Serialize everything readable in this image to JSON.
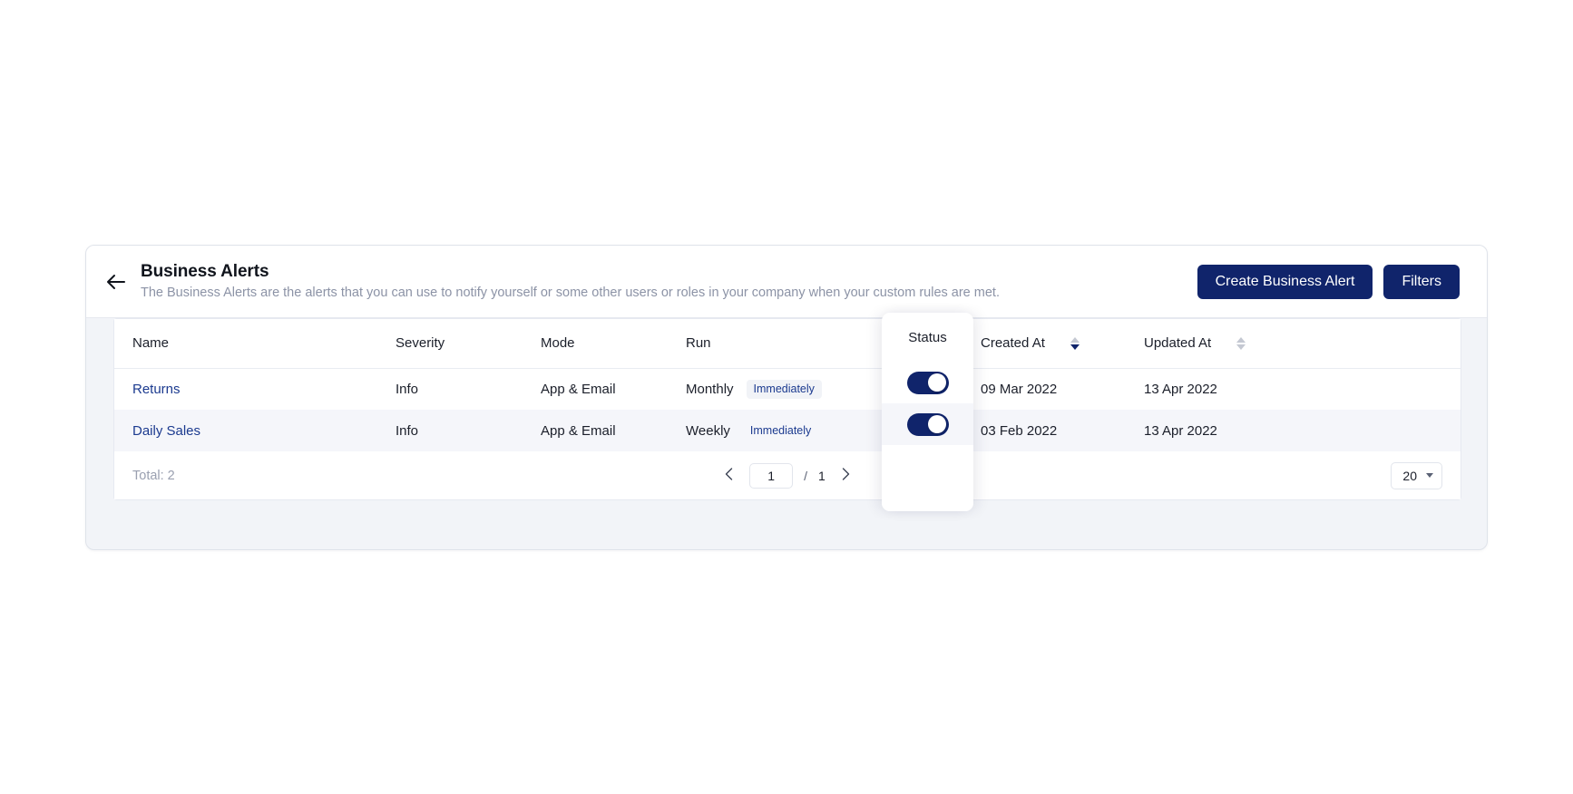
{
  "header": {
    "back_icon": "arrow-left-icon",
    "title": "Business Alerts",
    "description": "The Business Alerts are the alerts that you can use to notify yourself or some other users or roles in your company when your custom rules are met.",
    "create_button": "Create Business Alert",
    "filters_button": "Filters"
  },
  "table": {
    "columns": {
      "name": "Name",
      "severity": "Severity",
      "mode": "Mode",
      "run": "Run",
      "status": "Status",
      "created_at": "Created At",
      "updated_at": "Updated At"
    },
    "sort": {
      "created_at": "desc",
      "updated_at": "none"
    },
    "rows": [
      {
        "name": "Returns",
        "severity": "Info",
        "mode": "App & Email",
        "run": "Monthly",
        "run_badge": "Immediately",
        "status_on": true,
        "created_at": "09 Mar 2022",
        "updated_at": "13 Apr 2022"
      },
      {
        "name": "Daily Sales",
        "severity": "Info",
        "mode": "App & Email",
        "run": "Weekly",
        "run_badge": "Immediately",
        "status_on": true,
        "created_at": "03 Feb 2022",
        "updated_at": "13 Apr 2022"
      }
    ]
  },
  "footer": {
    "total": "Total: 2",
    "prev_icon": "chevron-left-icon",
    "next_icon": "chevron-right-icon",
    "current_page": "1",
    "page_separator": "/",
    "total_pages": "1",
    "page_size": "20",
    "page_size_icon": "chevron-down-icon"
  },
  "colors": {
    "brand_navy": "#10246b",
    "link_navy": "#1b3a8f",
    "row_alt": "#f5f6fa",
    "card_bg": "#f2f4f8"
  }
}
